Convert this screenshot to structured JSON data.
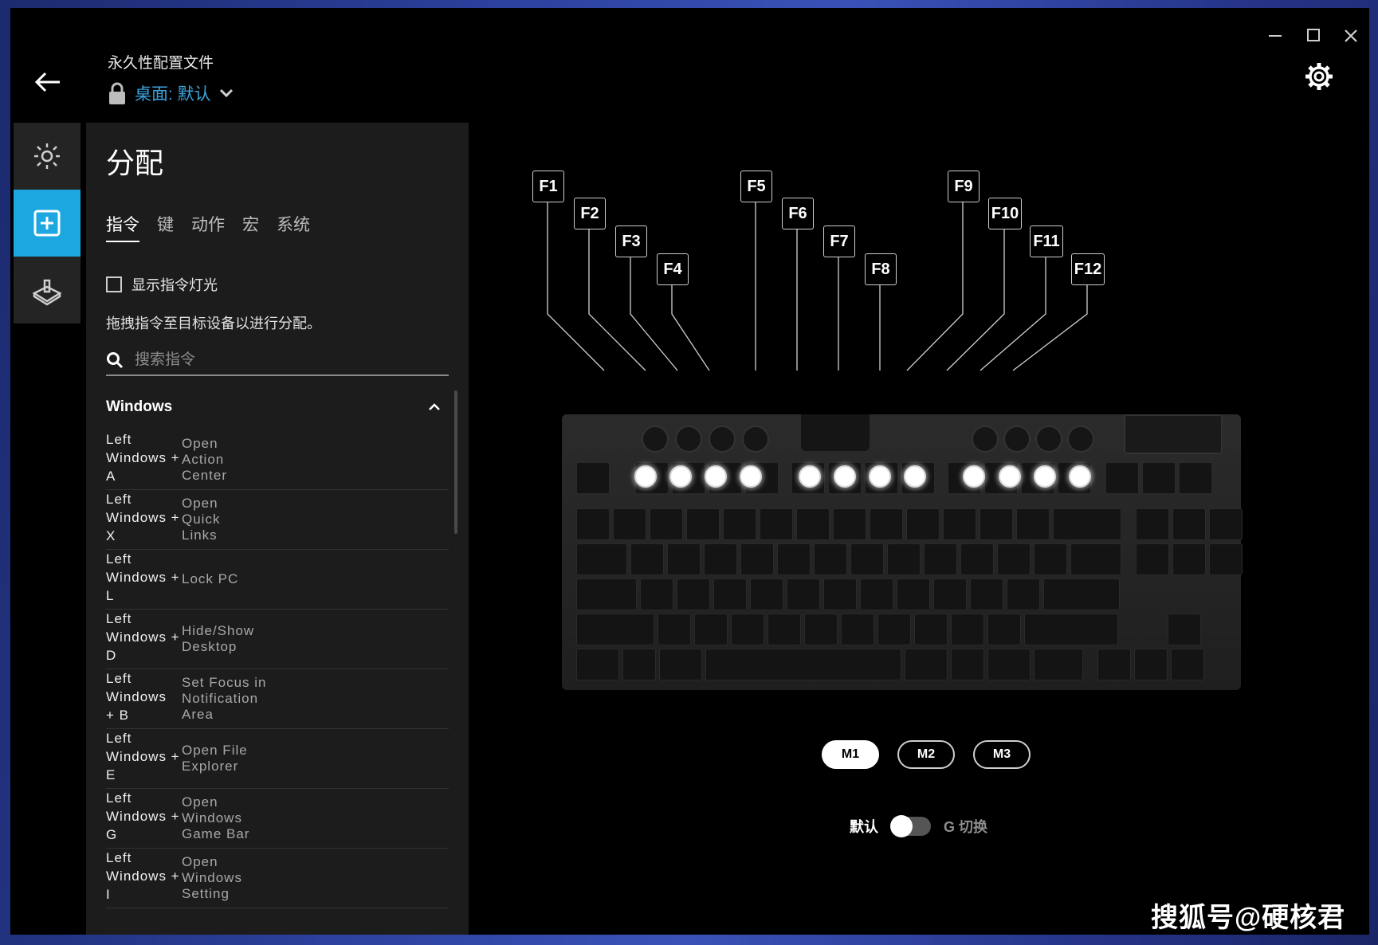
{
  "window": {
    "minimize": "minimize",
    "maximize": "maximize",
    "close": "close"
  },
  "header": {
    "profile_label": "永久性配置文件",
    "profile_name": "桌面: 默认"
  },
  "panel": {
    "title": "分配",
    "tabs": [
      "指令",
      "键",
      "动作",
      "宏",
      "系统"
    ],
    "show_lighting_label": "显示指令灯光",
    "hint": "拖拽指令至目标设备以进行分配。",
    "search_placeholder": "搜索指令",
    "group_title": "Windows",
    "commands": [
      {
        "keys": "Left\nWindows +\nA",
        "action": "Open\nAction\nCenter"
      },
      {
        "keys": "Left\nWindows +\nX",
        "action": "Open\nQuick\nLinks"
      },
      {
        "keys": "Left\nWindows +\nL",
        "action": "Lock PC"
      },
      {
        "keys": "Left\nWindows +\nD",
        "action": "Hide/Show\nDesktop"
      },
      {
        "keys": "Left\nWindows\n+ B",
        "action": "Set Focus in\nNotification\nArea"
      },
      {
        "keys": "Left\nWindows +\nE",
        "action": "Open File\nExplorer"
      },
      {
        "keys": "Left\nWindows +\nG",
        "action": "Open\nWindows\nGame Bar"
      },
      {
        "keys": "Left\nWindows +\nI",
        "action": "Open\nWindows\nSetting"
      }
    ]
  },
  "keyboard": {
    "fkeys": [
      "F1",
      "F2",
      "F3",
      "F4",
      "F5",
      "F6",
      "F7",
      "F8",
      "F9",
      "F10",
      "F11",
      "F12"
    ]
  },
  "memory": [
    "M1",
    "M2",
    "M3"
  ],
  "toggle": {
    "left": "默认",
    "right": "G 切换"
  },
  "watermark": "搜狐号@硬核君",
  "colors": {
    "accent": "#1ca7e0",
    "profile_link": "#3aa3dc",
    "panel_bg": "#1c1c1c",
    "rail_bg": "#242424"
  }
}
